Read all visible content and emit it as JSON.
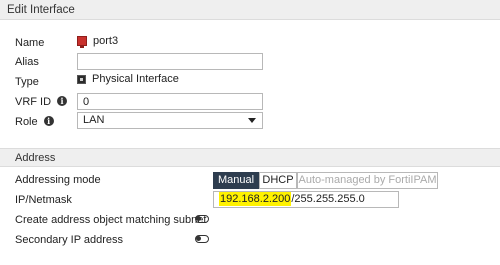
{
  "panel": {
    "title": "Edit Interface"
  },
  "form": {
    "name_label": "Name",
    "name_value": "port3",
    "alias_label": "Alias",
    "alias_value": "",
    "type_label": "Type",
    "type_value": "Physical Interface",
    "vrf_label": "VRF ID",
    "vrf_value": "0",
    "role_label": "Role",
    "role_value": "LAN"
  },
  "address": {
    "section_title": "Address",
    "mode_label": "Addressing mode",
    "modes": [
      "Manual",
      "DHCP",
      "Auto-managed by FortiIPAM"
    ],
    "selected_mode": "Manual",
    "ip_label": "IP/Netmask",
    "ip_value": "192.168.2.200",
    "netmask_value": "/255.255.255.0",
    "create_obj_label": "Create address object matching subnet",
    "create_obj_enabled": false,
    "secondary_label": "Secondary IP address",
    "secondary_enabled": false
  },
  "colors": {
    "active_segment": "#2e3d4f",
    "highlight": "#fff200",
    "port_icon": "#c8312d"
  },
  "icons": {
    "info": "i",
    "port": "port-icon",
    "type": "physical-interface-icon"
  }
}
